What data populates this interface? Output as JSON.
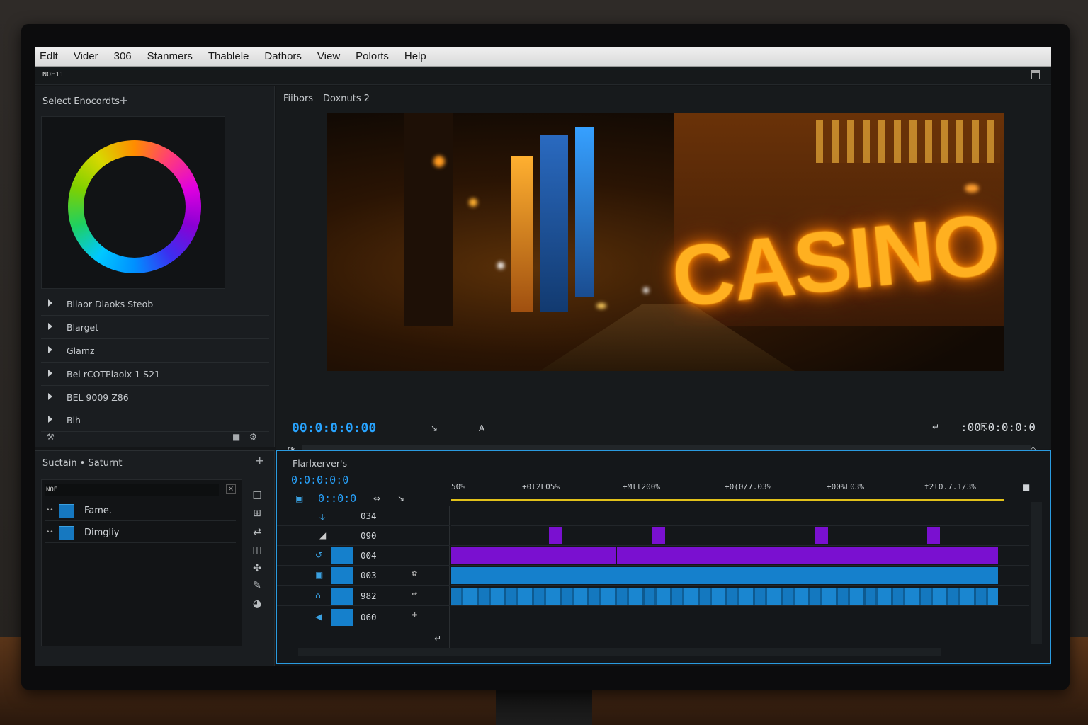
{
  "menu": [
    "Edlt",
    "Vider",
    "306",
    "Stanmers",
    "Thablele",
    "Dathors",
    "View",
    "Polorts",
    "Help"
  ],
  "app_title": "NOE11",
  "left_panel": {
    "title": "Select Enocordts",
    "tree": [
      "Bliaor Dlaoks Steob",
      "Blarget",
      "Glamz",
      "Bel rCOTPlaoix 1 S21",
      "BEL 9009 Z86",
      "Blh"
    ]
  },
  "project_panel": {
    "title": "Suctain • Saturnt",
    "search_value": "NOE",
    "items": [
      "Fame.",
      "Dimgliy"
    ]
  },
  "program": {
    "tab1": "Fiibors",
    "tab2": "Doxnuts 2",
    "sign_text": "CASINO",
    "timecode_left": "00:0:0:0:00",
    "timecode_right": ":00:0:0:0:0",
    "toggle_label": "A"
  },
  "timeline": {
    "title": "Flarlxerver's",
    "time1": "0:0:0:0:0",
    "time2": "0::0:0",
    "ruler": [
      "50%",
      "+0l2L05%",
      "+Mll200%",
      "+0(0/7.03%",
      "+00%L03%",
      "t2l0.7.1/3%"
    ],
    "tracks": [
      "034",
      "090",
      "004",
      "003",
      "982",
      "060"
    ]
  },
  "colors": {
    "accent_blue": "#28a4ff",
    "clip_purple": "#7a10d0",
    "clip_blue": "#1580cc",
    "playhead_yellow": "#e2c21a"
  }
}
